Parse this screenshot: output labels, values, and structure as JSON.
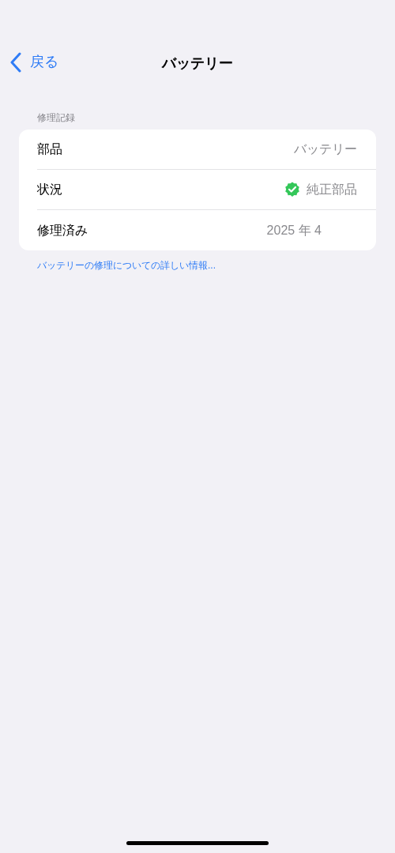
{
  "nav": {
    "back": "戻る",
    "title": "バッテリー"
  },
  "section": {
    "header": "修理記録",
    "rows": [
      {
        "label": "部品",
        "value": "バッテリー",
        "verified": false
      },
      {
        "label": "状況",
        "value": "純正部品",
        "verified": true
      },
      {
        "label": "修理済み",
        "value": "2025 年 4",
        "verified": false
      }
    ],
    "footer_link": "バッテリーの修理についての詳しい情報..."
  }
}
